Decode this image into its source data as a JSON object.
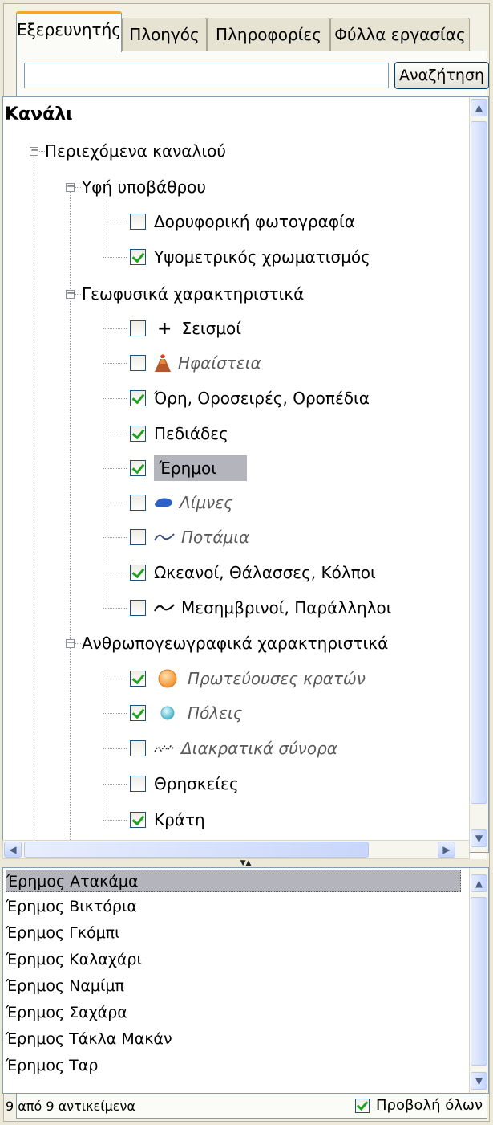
{
  "tabs": [
    {
      "label": "Εξερευνητής",
      "active": true
    },
    {
      "label": "Πλοηγός",
      "active": false
    },
    {
      "label": "Πληροφορίες",
      "active": false
    },
    {
      "label": "Φύλλα εργασίας",
      "active": false
    }
  ],
  "search": {
    "value": "",
    "button_label": "Αναζήτηση"
  },
  "tree": {
    "root": "Κανάλι",
    "channel_contents": "Περιεχόμενα καναλιού",
    "groups": {
      "background": {
        "label": "Υφή υποβάθρου",
        "items": {
          "satellite": {
            "label": "Δορυφορική φωτογραφία",
            "checked": false
          },
          "hypsometric": {
            "label": "Υψομετρικός χρωματισμός",
            "checked": true
          }
        }
      },
      "physical": {
        "label": "Γεωφυσικά χαρακτηριστικά",
        "items": {
          "earthquakes": {
            "label": "Σεισμοί",
            "checked": false,
            "icon": "cross-icon"
          },
          "volcanoes": {
            "label": "Ηφαίστεια",
            "checked": false,
            "icon": "volcano-icon"
          },
          "mountains": {
            "label": "Όρη, Οροσειρές, Οροπέδια",
            "checked": true
          },
          "plains": {
            "label": "Πεδιάδες",
            "checked": true
          },
          "deserts": {
            "label": "Έρημοι",
            "checked": true,
            "selected": true
          },
          "lakes": {
            "label": "Λίμνες",
            "checked": false,
            "icon": "lake-icon"
          },
          "rivers": {
            "label": "Ποτάμια",
            "checked": false,
            "icon": "river-icon"
          },
          "oceans": {
            "label": "Ωκεανοί, Θάλασσες, Κόλποι",
            "checked": true
          },
          "meridians": {
            "label": "Μεσημβρινοί, Παράλληλοι",
            "checked": false,
            "icon": "wave-line-icon"
          }
        }
      },
      "human": {
        "label": "Ανθρωπογεωγραφικά χαρακτηριστικά",
        "items": {
          "capitals": {
            "label": "Πρωτεύουσες κρατών",
            "checked": true,
            "icon": "capital-dot-icon"
          },
          "cities": {
            "label": "Πόλεις",
            "checked": true,
            "icon": "city-dot-icon"
          },
          "borders": {
            "label": "Διακρατικά σύνορα",
            "checked": false,
            "icon": "border-line-icon"
          },
          "religions": {
            "label": "Θρησκείες",
            "checked": false
          },
          "states": {
            "label": "Κράτη",
            "checked": true
          }
        }
      }
    }
  },
  "results": [
    "Έρημος Ατακάμα",
    "Έρημος Βικτόρια",
    "Έρημος Γκόμπι",
    "Έρημος Καλαχάρι",
    "Έρημος Ναμίμπ",
    "Έρημος Σαχάρα",
    "Έρημος Τάκλα Μακάν",
    "Έρημος Ταρ"
  ],
  "footer": {
    "count_text": "9 από 9 αντικείμενα",
    "show_all_label": "Προβολή όλων",
    "show_all_checked": true
  },
  "colors": {
    "selection": "#b4b4bc",
    "check": "#21a121",
    "active_tab_accent": "#f0a832"
  }
}
